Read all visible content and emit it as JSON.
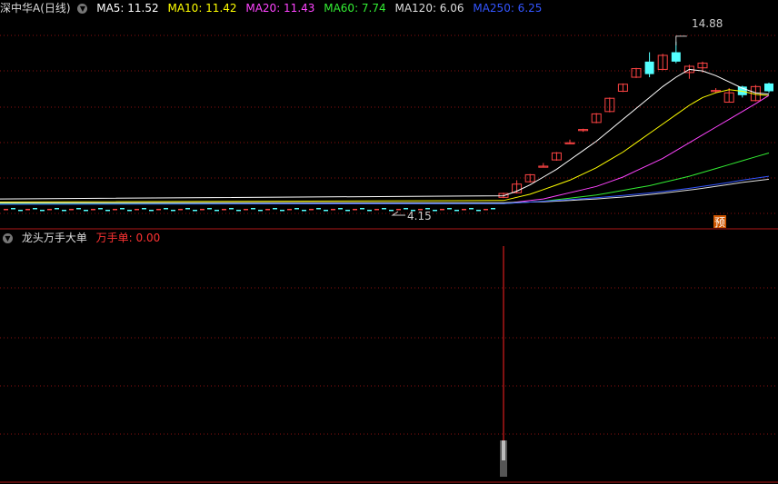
{
  "main_panel": {
    "stock_name": "深中华A(日线)",
    "ma_items": [
      {
        "label": "MA5: 11.52",
        "color": "#ffffff"
      },
      {
        "label": "MA10: 11.42",
        "color": "#ffff00"
      },
      {
        "label": "MA20: 11.43",
        "color": "#ff44ff"
      },
      {
        "label": "MA60: 7.74",
        "color": "#33ee33"
      },
      {
        "label": "MA120: 6.06",
        "color": "#dddddd"
      },
      {
        "label": "MA250: 6.25",
        "color": "#3355ff"
      }
    ],
    "high_label": "14.88",
    "low_label": "4.15",
    "pred_badge": "预"
  },
  "sub_panel": {
    "indicator_name": "龙头万手大单",
    "value_label": "万手单: 0.00"
  },
  "colors": {
    "up": "#ff4444",
    "down": "#54ffff",
    "grid": "#8a1010"
  },
  "chart_data": [
    {
      "type": "candlestick",
      "title": "深中华A(日线)",
      "ylim": [
        3.0,
        16.5
      ],
      "candles": [
        {
          "o": 4.9,
          "h": 5.2,
          "l": 4.85,
          "c": 5.15
        },
        {
          "o": 5.2,
          "h": 6.0,
          "l": 5.15,
          "c": 5.75
        },
        {
          "o": 5.9,
          "h": 6.4,
          "l": 5.85,
          "c": 6.35
        },
        {
          "o": 6.9,
          "h": 7.1,
          "l": 6.85,
          "c": 6.9
        },
        {
          "o": 7.3,
          "h": 7.8,
          "l": 7.25,
          "c": 7.75
        },
        {
          "o": 8.4,
          "h": 8.6,
          "l": 8.35,
          "c": 8.4
        },
        {
          "o": 9.2,
          "h": 9.3,
          "l": 9.1,
          "c": 9.25
        },
        {
          "o": 9.7,
          "h": 10.3,
          "l": 9.65,
          "c": 10.25
        },
        {
          "o": 10.4,
          "h": 11.3,
          "l": 10.35,
          "c": 11.25
        },
        {
          "o": 11.7,
          "h": 12.2,
          "l": 11.65,
          "c": 12.15
        },
        {
          "o": 12.6,
          "h": 13.2,
          "l": 12.55,
          "c": 13.15
        },
        {
          "o": 13.6,
          "h": 14.2,
          "l": 12.6,
          "c": 12.8
        },
        {
          "o": 13.1,
          "h": 14.1,
          "l": 13.05,
          "c": 14.0
        },
        {
          "o": 14.2,
          "h": 14.88,
          "l": 13.5,
          "c": 13.6
        },
        {
          "o": 12.9,
          "h": 13.4,
          "l": 12.5,
          "c": 13.3
        },
        {
          "o": 13.2,
          "h": 13.6,
          "l": 12.9,
          "c": 13.5
        },
        {
          "o": 11.7,
          "h": 11.9,
          "l": 11.6,
          "c": 11.75
        },
        {
          "o": 11.0,
          "h": 11.9,
          "l": 11.0,
          "c": 11.6
        },
        {
          "o": 12.0,
          "h": 12.05,
          "l": 11.3,
          "c": 11.45
        },
        {
          "o": 11.1,
          "h": 12.1,
          "l": 11.05,
          "c": 12.0
        },
        {
          "o": 12.2,
          "h": 12.25,
          "l": 11.6,
          "c": 11.7
        }
      ],
      "series": [
        {
          "name": "MA5",
          "color": "#ffffff",
          "values": [
            4.8,
            5.0,
            5.3,
            5.7,
            6.2,
            6.7,
            7.3,
            7.9,
            8.5,
            9.2,
            9.9,
            10.6,
            11.3,
            12.0,
            12.6,
            13.1,
            13.0,
            12.7,
            12.3,
            11.9,
            11.6,
            11.52
          ]
        },
        {
          "name": "MA10",
          "color": "#ffff00",
          "values": [
            4.6,
            4.7,
            4.9,
            5.1,
            5.4,
            5.7,
            6.0,
            6.4,
            6.8,
            7.3,
            7.8,
            8.4,
            9.0,
            9.6,
            10.2,
            10.8,
            11.3,
            11.6,
            11.8,
            11.7,
            11.5,
            11.42
          ]
        },
        {
          "name": "MA20",
          "color": "#ff44ff",
          "values": [
            4.5,
            4.5,
            4.6,
            4.7,
            4.8,
            5.0,
            5.2,
            5.4,
            5.6,
            5.9,
            6.2,
            6.6,
            7.0,
            7.4,
            7.9,
            8.4,
            8.9,
            9.4,
            9.9,
            10.4,
            10.9,
            11.43
          ]
        },
        {
          "name": "MA60",
          "color": "#33ee33",
          "values": [
            4.5,
            4.5,
            4.55,
            4.6,
            4.65,
            4.75,
            4.85,
            4.95,
            5.05,
            5.2,
            5.35,
            5.5,
            5.65,
            5.85,
            6.05,
            6.25,
            6.5,
            6.75,
            7.0,
            7.25,
            7.5,
            7.74
          ]
        },
        {
          "name": "MA120",
          "color": "#dddddd",
          "values": [
            4.55,
            4.56,
            4.58,
            4.6,
            4.62,
            4.66,
            4.7,
            4.75,
            4.8,
            4.86,
            4.92,
            5.0,
            5.08,
            5.17,
            5.27,
            5.37,
            5.48,
            5.6,
            5.73,
            5.86,
            5.96,
            6.06
          ]
        },
        {
          "name": "MA250",
          "color": "#3355ff",
          "values": [
            4.45,
            4.5,
            4.55,
            4.6,
            4.65,
            4.7,
            4.76,
            4.82,
            4.88,
            4.95,
            5.02,
            5.1,
            5.18,
            5.27,
            5.37,
            5.48,
            5.6,
            5.73,
            5.86,
            6.0,
            6.13,
            6.25
          ]
        }
      ]
    },
    {
      "type": "bar",
      "title": "龙头万手大单",
      "series": [
        {
          "name": "万手单",
          "values": [
            0.0
          ]
        }
      ]
    }
  ]
}
